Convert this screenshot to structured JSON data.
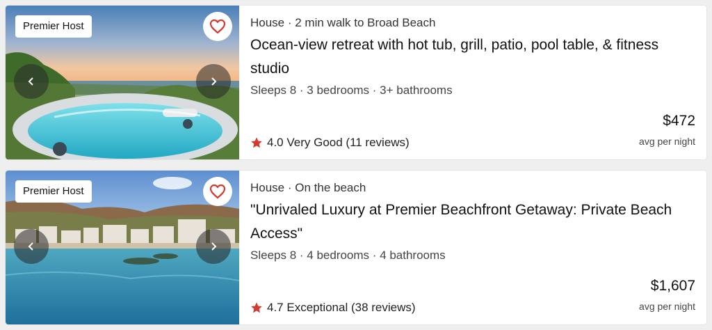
{
  "listings": [
    {
      "badge": "Premier Host",
      "property_line": "House · 2 min walk to Broad Beach",
      "title": "Ocean-view retreat with hot tub, grill, patio, pool table, & fitness studio",
      "details": "Sleeps 8 · 3 bedrooms · 3+ bathrooms",
      "rating_text": "4.0 Very Good (11 reviews)",
      "price": "$472",
      "price_note": "avg per night"
    },
    {
      "badge": "Premier Host",
      "property_line": "House · On the beach",
      "title": "\"Unrivaled Luxury at Premier Beachfront Getaway: Private Beach Access\"",
      "details": "Sleeps 8 · 4 bedrooms · 4 bathrooms",
      "rating_text": "4.7 Exceptional (38 reviews)",
      "price": "$1,607",
      "price_note": "avg per night"
    }
  ],
  "colors": {
    "star": "#d23a2d",
    "heart": "#d23a2d"
  }
}
